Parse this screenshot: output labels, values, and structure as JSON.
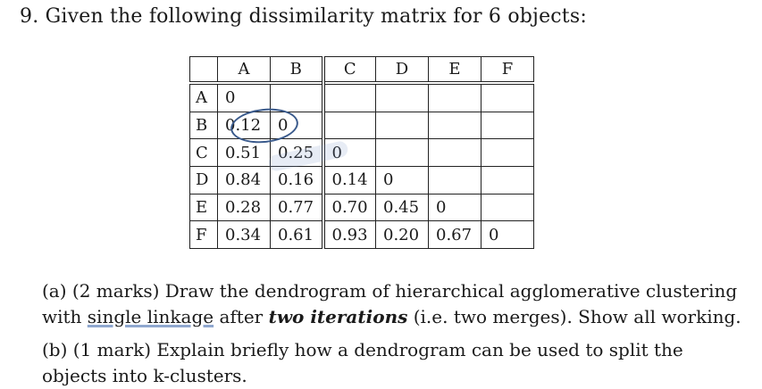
{
  "question": {
    "number": "9.",
    "title": "Given the following dissimilarity matrix for 6 objects:"
  },
  "matrix": {
    "columns": [
      "A",
      "B",
      "C",
      "D",
      "E",
      "F"
    ],
    "rows": [
      {
        "label": "A",
        "values": [
          "0",
          "",
          "",
          "",
          "",
          ""
        ]
      },
      {
        "label": "B",
        "values": [
          "0.12",
          "0",
          "",
          "",
          "",
          ""
        ]
      },
      {
        "label": "C",
        "values": [
          "0.51",
          "0.25",
          "0",
          "",
          "",
          ""
        ]
      },
      {
        "label": "D",
        "values": [
          "0.84",
          "0.16",
          "0.14",
          "0",
          "",
          ""
        ]
      },
      {
        "label": "E",
        "values": [
          "0.28",
          "0.77",
          "0.70",
          "0.45",
          "0",
          ""
        ]
      },
      {
        "label": "F",
        "values": [
          "0.34",
          "0.61",
          "0.93",
          "0.20",
          "0.67",
          "0"
        ]
      }
    ]
  },
  "parts": {
    "a": {
      "prefix": "(a) (2 marks) Draw the dendrogram of hierarchical agglomerative clustering with ",
      "underlined": "single linkage",
      "middle": " after ",
      "emphasis": "two iterations",
      "suffix": " (i.e. two merges). Show all working."
    },
    "b": {
      "text": "(b) (1 mark) Explain briefly how a dendrogram can be used to split the objects into k-clusters."
    }
  },
  "colors": {
    "annotation_ink": "#3a5a8c"
  }
}
